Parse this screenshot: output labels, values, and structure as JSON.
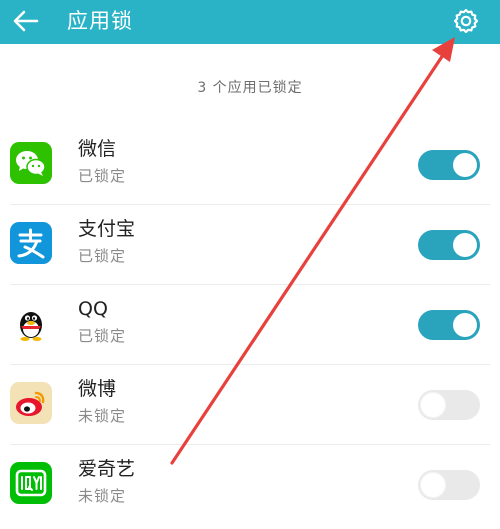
{
  "header": {
    "title": "应用锁",
    "back_icon": "back-arrow-icon",
    "settings_icon": "gear-icon",
    "background": "#2ab3c6"
  },
  "summary": "3 个应用已锁定",
  "apps": [
    {
      "name": "微信",
      "status": "已锁定",
      "locked": true,
      "icon": "wechat-icon",
      "icon_color": "#2dc100"
    },
    {
      "name": "支付宝",
      "status": "已锁定",
      "locked": true,
      "icon": "alipay-icon",
      "icon_color": "#1296db"
    },
    {
      "name": "QQ",
      "status": "已锁定",
      "locked": true,
      "icon": "qq-penguin-icon",
      "icon_color": "#000000"
    },
    {
      "name": "微博",
      "status": "未锁定",
      "locked": false,
      "icon": "weibo-icon",
      "icon_color": "#e6162d"
    },
    {
      "name": "爱奇艺",
      "status": "未锁定",
      "locked": false,
      "icon": "iqiyi-icon",
      "icon_color": "#00be06"
    }
  ],
  "colors": {
    "toggle_on": "#2aa3bd",
    "toggle_off": "#e9e9e9",
    "annotation_arrow": "#e8403c"
  }
}
